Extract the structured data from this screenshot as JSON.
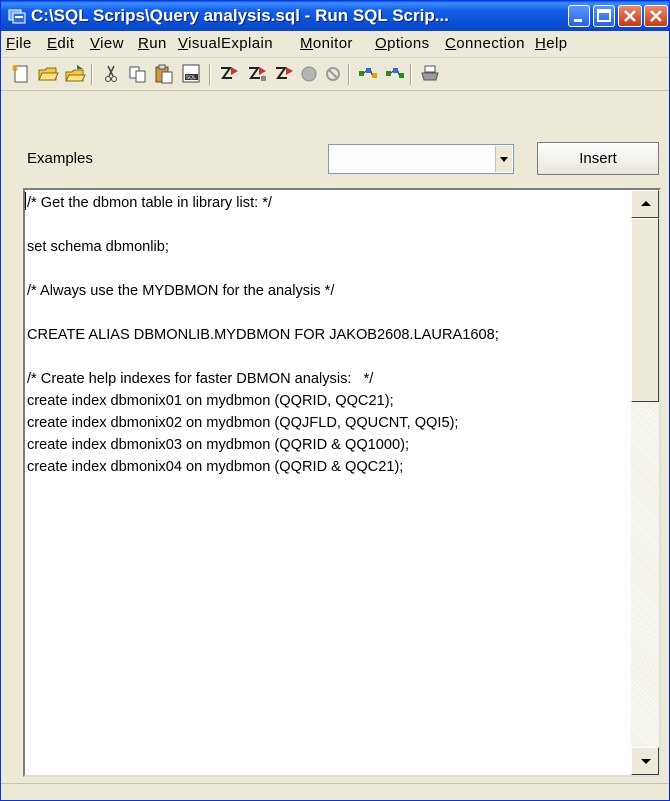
{
  "window": {
    "title": "C:\\SQL Scrips\\Query analysis.sql - Run SQL Scrip..."
  },
  "menu": [
    "File",
    "Edit",
    "View",
    "Run",
    "VisualExplain",
    "Monitor",
    "Options",
    "Connection",
    "Help"
  ],
  "toolbar_icons": [
    "new-file-icon",
    "open-folder-icon",
    "open-remote-icon",
    "cut-icon",
    "copy-icon",
    "paste-icon",
    "sql-insert-icon",
    "run-all-icon",
    "run-from-selected-icon",
    "run-selected-icon",
    "stop-icon",
    "cancel-icon",
    "explain-icon",
    "run-and-explain-icon",
    "print-icon"
  ],
  "examples": {
    "label": "Examples",
    "selected": "",
    "insert_label": "Insert"
  },
  "editor": {
    "lines": [
      "/* Get the dbmon table in library list: */",
      "",
      "set schema dbmonlib;",
      "",
      "/* Always use the MYDBMON for the analysis */",
      "",
      "CREATE ALIAS DBMONLIB.MYDBMON FOR JAKOB2608.LAURA1608;",
      "",
      "/* Create help indexes for faster DBMON analysis:   */",
      "create index dbmonix01 on mydbmon (QQRID, QQC21);",
      "create index dbmonix02 on mydbmon (QQJFLD, QQUCNT, QQI5);",
      "create index dbmonix03 on mydbmon (QQRID & QQ1000);",
      "create index dbmonix04 on mydbmon (QQRID & QQC21);"
    ]
  }
}
